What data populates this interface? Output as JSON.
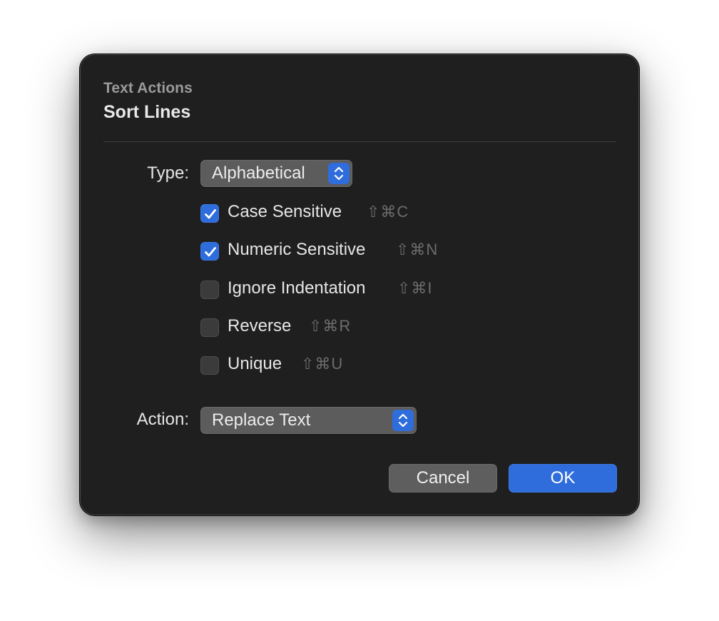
{
  "dialog": {
    "subtitle": "Text Actions",
    "title": "Sort Lines"
  },
  "type_field": {
    "label": "Type:",
    "value": "Alphabetical"
  },
  "options": [
    {
      "label": "Case Sensitive",
      "shortcut": "⇧⌘C",
      "checked": true
    },
    {
      "label": "Numeric Sensitive",
      "shortcut": "⇧⌘N",
      "checked": true
    },
    {
      "label": "Ignore Indentation",
      "shortcut": "⇧⌘I",
      "checked": false
    },
    {
      "label": "Reverse",
      "shortcut": "⇧⌘R",
      "checked": false
    },
    {
      "label": "Unique",
      "shortcut": "⇧⌘U",
      "checked": false
    }
  ],
  "action_field": {
    "label": "Action:",
    "value": "Replace Text"
  },
  "buttons": {
    "cancel_label": "Cancel",
    "ok_label": "OK"
  },
  "colors": {
    "accent": "#2f6ddc",
    "dialog_background": "#1f1f1f"
  },
  "icons": {
    "checkmark": "checkmark-icon",
    "popup_stepper": "chevron-up-down-icon"
  }
}
